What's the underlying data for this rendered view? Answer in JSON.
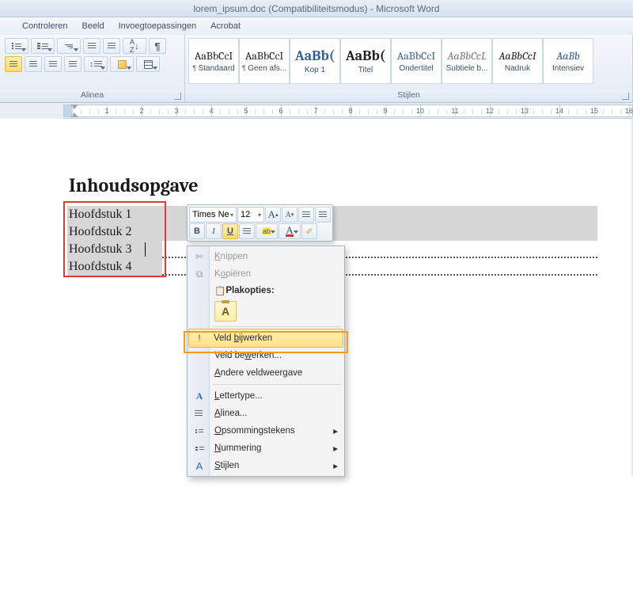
{
  "titlebar": "lorem_ipsum.doc (Compatibiliteitsmodus) - Microsoft Word",
  "tabs": {
    "t1": "Controleren",
    "t2": "Beeld",
    "t3": "Invoegtoepassingen",
    "t4": "Acrobat"
  },
  "ribbon": {
    "para_label": "Alinea",
    "styles_label": "Stijlen",
    "sort": "A↓Z",
    "styles": [
      {
        "sample": "AaBbCcI",
        "name": "Standaard",
        "cls": "smmed",
        "para": true
      },
      {
        "sample": "AaBbCcI",
        "name": "Geen afs...",
        "cls": "smmed",
        "para": true
      },
      {
        "sample": "AaBb(",
        "name": "Kop 1",
        "cls": "smbig blue"
      },
      {
        "sample": "AaBb(",
        "name": "Titel",
        "cls": "smbig"
      },
      {
        "sample": "AaBbCcI",
        "name": "Ondertitel",
        "cls": "smmed blue"
      },
      {
        "sample": "AaBbCcL",
        "name": "Subtiele b...",
        "cls": "smmed smita sub"
      },
      {
        "sample": "AaBbCcI",
        "name": "Nadruk",
        "cls": "smmed smita"
      },
      {
        "sample": "AaBb",
        "name": "Intensiev",
        "cls": "smmed smita blue"
      }
    ]
  },
  "ruler_numbers": [
    "1",
    "",
    "1",
    "2",
    "3",
    "4",
    "5",
    "6",
    "7",
    "8",
    "9",
    "10",
    "11",
    "12",
    "13",
    "14",
    "15"
  ],
  "doc": {
    "heading": "Inhoudsopgave",
    "toc": [
      "Hoofdstuk 1",
      "Hoofdstuk 2",
      "Hoofdstuk 3",
      "Hoofdstuk 4"
    ]
  },
  "minitb": {
    "font": "Times Ne",
    "size": "12",
    "grow": "A",
    "shrink": "A",
    "bold": "B",
    "italic": "I",
    "underline": "U",
    "center": "≡",
    "highlight": "ab",
    "fontcolorA": "A",
    "format": "✎"
  },
  "ctx": {
    "cut": "Knippen",
    "copy": "Kopiëren",
    "paste_header": "Plakopties:",
    "pasteA": "A",
    "update": "Veld bijwerken",
    "update_u": "b",
    "edit": "Veld bewerken...",
    "edit_u": "w",
    "toggle": "Andere veldweergave",
    "toggle_u": "A",
    "font": "Lettertype...",
    "font_u": "L",
    "para": "Alinea...",
    "para_u": "A",
    "bullets": "Opsommingstekens",
    "bullets_u": "O",
    "numbering": "Nummering",
    "numbering_u": "N",
    "styles": "Stijlen",
    "styles_u": "S"
  }
}
